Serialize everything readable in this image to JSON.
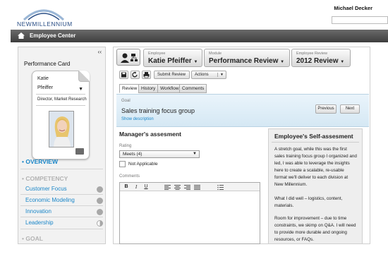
{
  "brand": {
    "logo_text": "NewMillennium"
  },
  "topbar": {
    "user_name": "Michael Decker"
  },
  "appbar": {
    "title": "Employee Center"
  },
  "sidebar": {
    "title": "Performance Card",
    "card": {
      "first_name": "Katie",
      "last_name": "Pfeiffer",
      "role": "Director, Market Research"
    },
    "overview": "OVERVIEW",
    "sections": [
      {
        "label": "COMPETENCY"
      },
      {
        "label": "GOAL"
      }
    ],
    "items": [
      {
        "label": "Customer Focus",
        "status": "full"
      },
      {
        "label": "Economic Modeling",
        "status": "full"
      },
      {
        "label": "Innovation",
        "status": "full"
      },
      {
        "label": "Leadership",
        "status": "half"
      }
    ]
  },
  "header": {
    "employee_label": "Employee",
    "employee_value": "Katie Pfeiffer",
    "module_label": "Module",
    "module_value": "Performance Review",
    "review_label": "Employee Review",
    "review_value": "2012 Review"
  },
  "toolbar": {
    "submit_label": "Submit Review",
    "actions_label": "Actions"
  },
  "tabs": [
    "Review",
    "History",
    "Workflow",
    "Comments"
  ],
  "goal": {
    "label": "Goal",
    "title": "Sales training focus group",
    "show_description": "Show description",
    "previous": "Previous",
    "next": "Next"
  },
  "manager": {
    "title": "Manager's assesment",
    "rating_label": "Rating",
    "rating_value": "Meets (4)",
    "not_applicable": "Not Applicable",
    "comments_label": "Comments",
    "editor_buttons": [
      "B",
      "I",
      "U"
    ]
  },
  "self": {
    "title": "Employee's Self-assesment",
    "paragraphs": [
      "A stretch goal, while this was the first sales training focus group I organized and led, I was able to leverage the insights here to create a scalable, re-usable format we'll deliver to each division at New Millennium.",
      "What I did well – logistics, content, materials.",
      "Room for improvement – due to time constraints, we skimp on Q&A. I will need to provide more durable and ongoing resources, or FAQs."
    ]
  },
  "colors": {
    "accent": "#1a86c8",
    "header": "#4a4a4a",
    "goal_panel": "#dcecf7"
  }
}
